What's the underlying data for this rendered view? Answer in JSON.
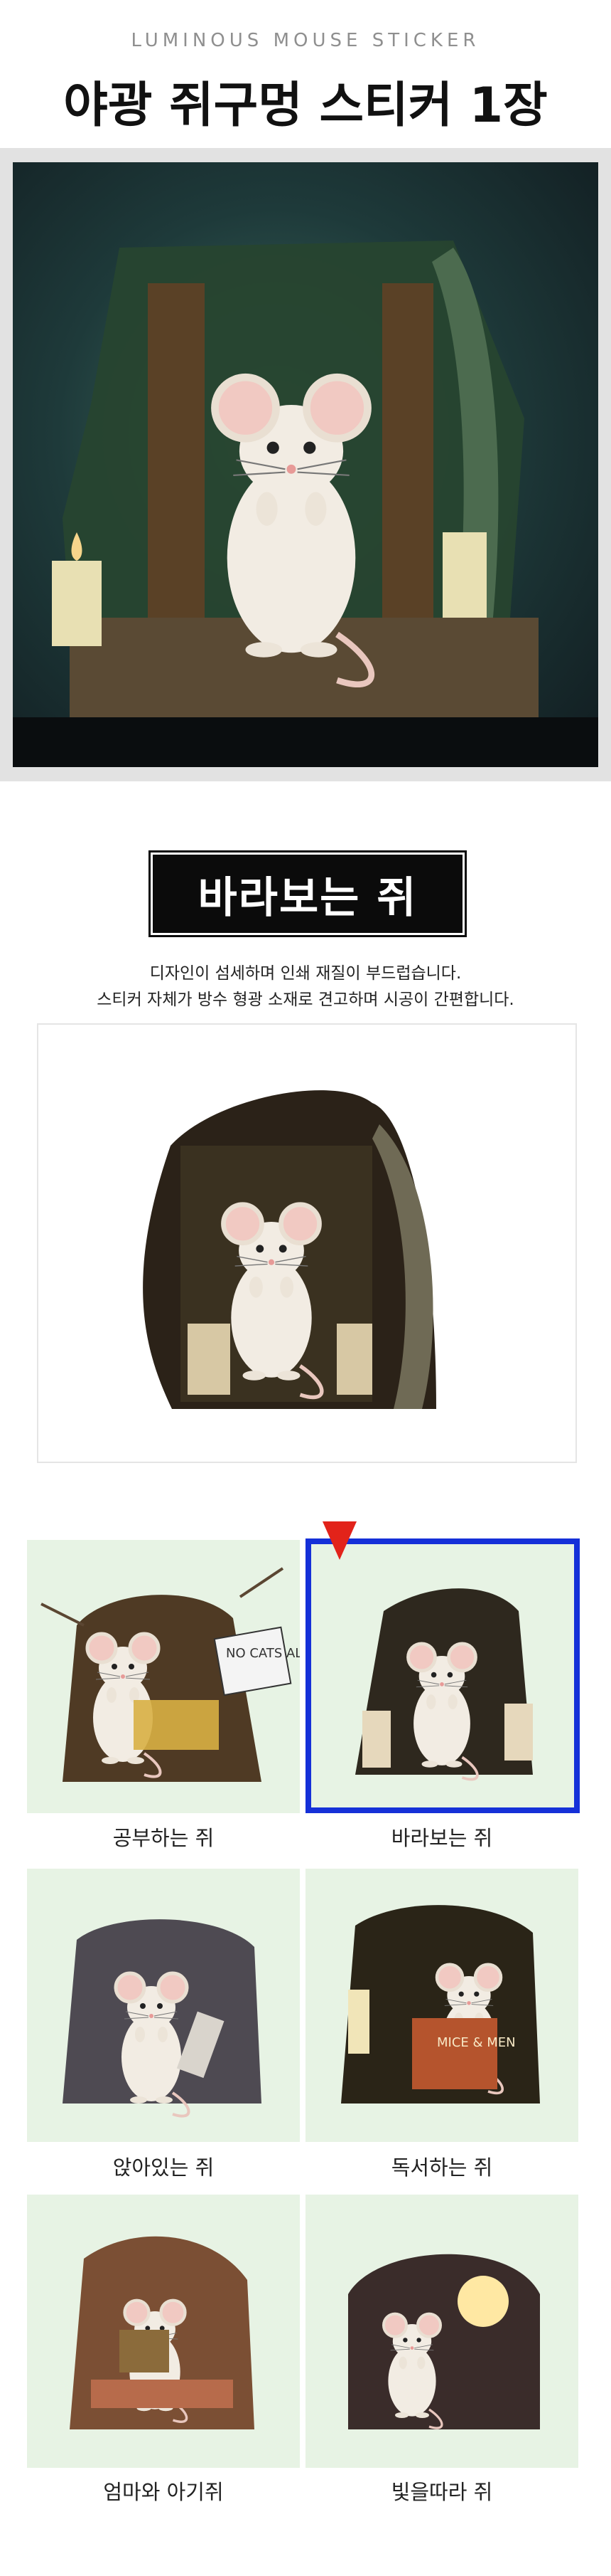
{
  "header": {
    "eyebrow": "LUMINOUS MOUSE STICKER",
    "title": "야광 쥐구멍 스티커 1장"
  },
  "hero": {
    "image": "mouse-standing-in-glowing-mousehole"
  },
  "featured": {
    "name": "바라보는 쥐",
    "description_lines": [
      "디자인이 섬세하며 인쇄 재질이 부드럽습니다.",
      "스티커 자체가 방수 형광 소재로 견고하며 시공이 간편합니다."
    ]
  },
  "options": [
    {
      "label": "공부하는 쥐",
      "selected": false,
      "sign_text": "NO CATS ALLOWED"
    },
    {
      "label": "바라보는 쥐",
      "selected": true
    },
    {
      "label": "앉아있는 쥐",
      "selected": false
    },
    {
      "label": "독서하는 쥐",
      "selected": false,
      "book_text": "MICE & MEN"
    },
    {
      "label": "엄마와 아기쥐",
      "selected": false
    },
    {
      "label": "빛을따라 쥐",
      "selected": false
    }
  ],
  "colors": {
    "selection_border": "#1530d8",
    "pointer": "#e2231a",
    "tile_bg": "#e7f3e4"
  }
}
